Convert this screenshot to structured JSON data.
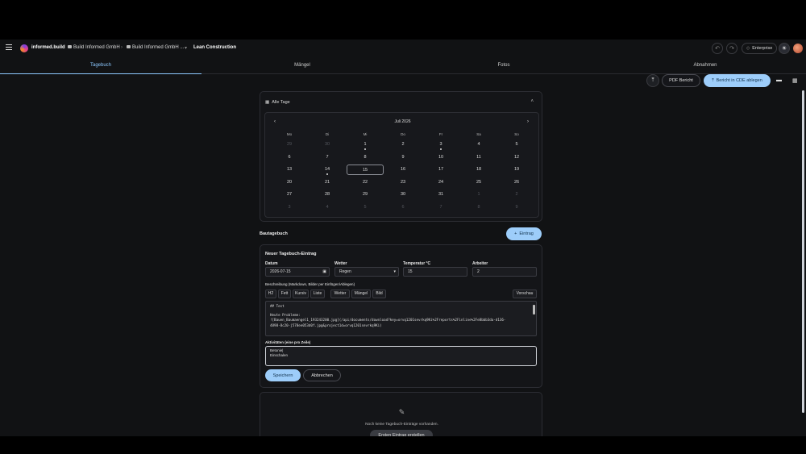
{
  "app": {
    "logo_text": "informed.build",
    "org": "Build Informed GmbH",
    "workspace": "Build Informed GmbH ...",
    "project": "Lean Construction",
    "edition": "Enterprise"
  },
  "tabs": [
    "Tagebuch",
    "Mängel",
    "Fotos",
    "Abnahmen"
  ],
  "actions": {
    "pdf": "PDF Bericht",
    "cde": "Bericht in CDE ablegen"
  },
  "calendar": {
    "filter_label": "Alle Tage",
    "month": "Juli 2026",
    "weekdays": [
      "Mo",
      "Di",
      "Mi",
      "Do",
      "Fr",
      "Sa",
      "So"
    ],
    "weeks": [
      [
        "29",
        "30",
        "1",
        "2",
        "3",
        "4",
        "5"
      ],
      [
        "6",
        "7",
        "8",
        "9",
        "10",
        "11",
        "12"
      ],
      [
        "13",
        "14",
        "15",
        "16",
        "17",
        "18",
        "19"
      ],
      [
        "20",
        "21",
        "22",
        "23",
        "24",
        "25",
        "26"
      ],
      [
        "27",
        "28",
        "29",
        "30",
        "31",
        "1",
        "2"
      ],
      [
        "3",
        "4",
        "5",
        "6",
        "7",
        "8",
        "9"
      ]
    ]
  },
  "diary": {
    "section_title": "Bautagebuch",
    "add_button": "Eintrag",
    "form_title": "Neuer Tagebuch-Eintrag",
    "date_label": "Datum",
    "date_value": "2026-07-15",
    "weather_label": "Wetter",
    "weather_value": "Regen",
    "temp_label": "Temperatur °C",
    "temp_value": "15",
    "workers_label": "Arbeiter",
    "workers_value": "2",
    "desc_label": "Beschreibung (Markdown, Bilder per Einfügen/Ablegen)",
    "toolbar": [
      "H2",
      "Fett",
      "Kursiv",
      "Liste",
      "Wetter",
      "Mängel",
      "Bild"
    ],
    "preview": "Vorschau",
    "desc_line1": "## Test",
    "desc_line2": "Heute Probleme:",
    "desc_line3": "![Bauen_Baumaengel1_193243200.jpg](/api/documents/download?key=orvq1201sevrkq9Ki%2Freports%2Finline%2Fe8bbb3da-d136-",
    "desc_line4": "4898-8c20-j578ee053d0f.jpg&project1d=orvq1201sevrkq9Ki)",
    "activities_label": "Aktivitäten (eine pro Zeile)",
    "activity1": "Betonie|",
    "activity2": "Einschalen",
    "save": "Speichern",
    "cancel": "Abbrechen",
    "empty_text": "Noch keine Tagebuch-Einträge vorhanden.",
    "first_entry": "Ersten Eintrag erstellen"
  }
}
